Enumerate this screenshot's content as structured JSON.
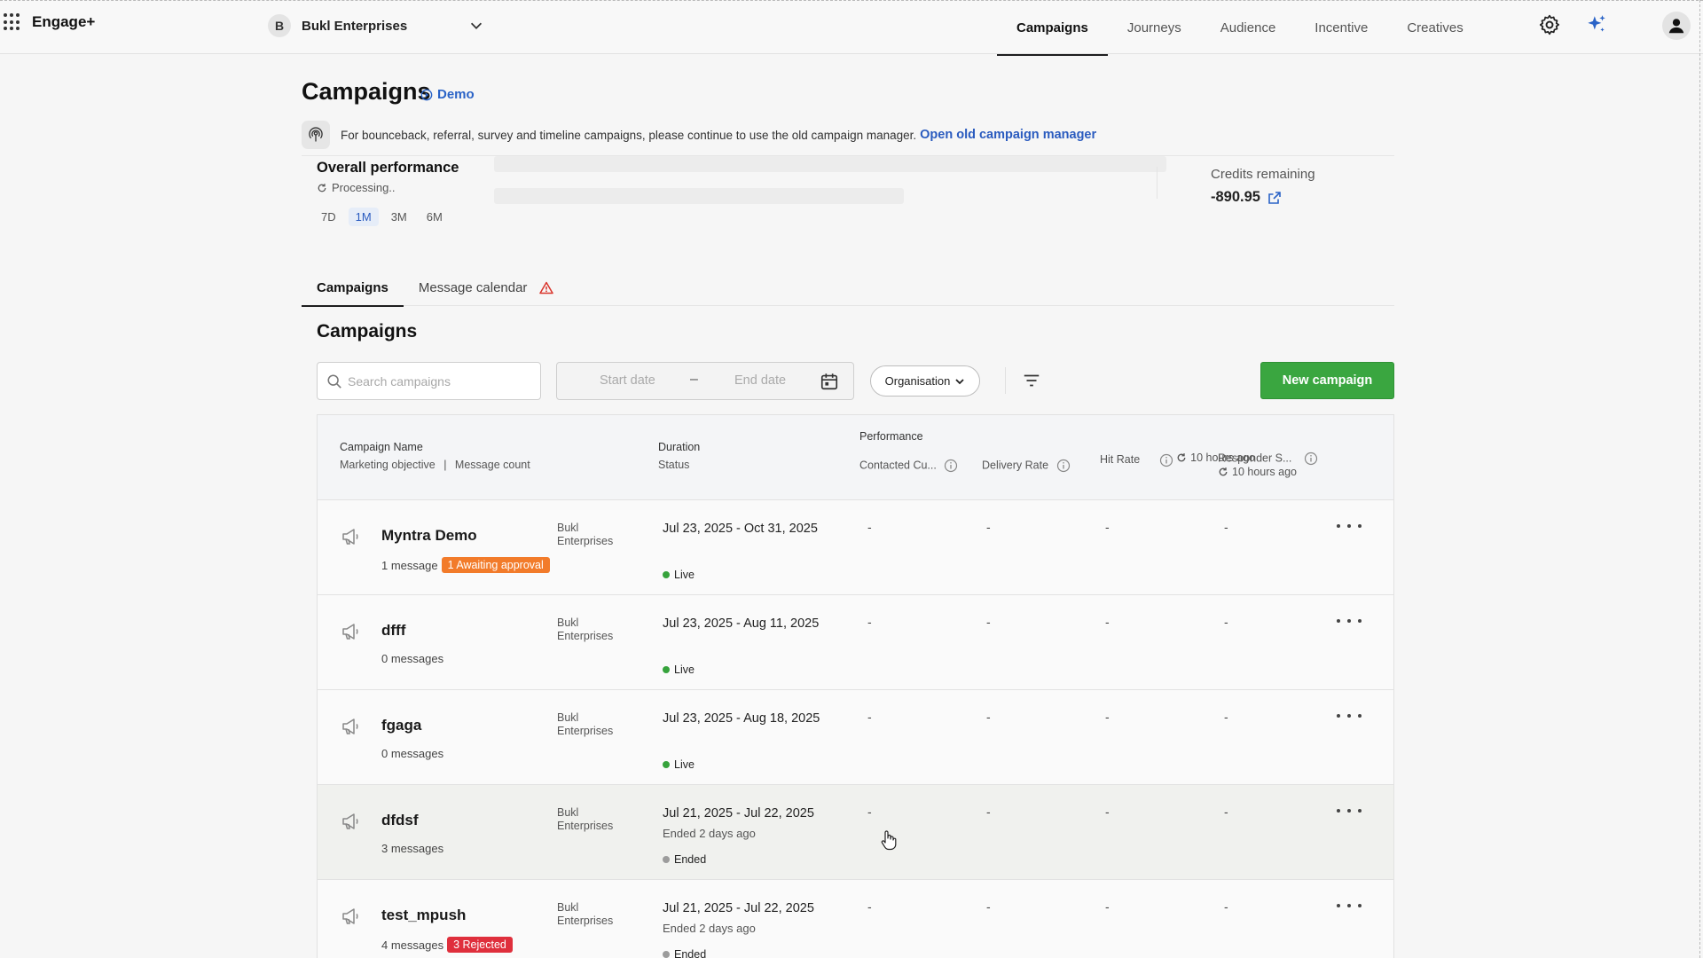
{
  "app": {
    "name": "Engage+"
  },
  "org": {
    "initial": "B",
    "name": "Bukl Enterprises"
  },
  "nav": {
    "items": [
      {
        "label": "Campaigns",
        "active": true
      },
      {
        "label": "Journeys",
        "active": false
      },
      {
        "label": "Audience",
        "active": false
      },
      {
        "label": "Incentive",
        "active": false
      },
      {
        "label": "Creatives",
        "active": false
      }
    ],
    "icons": [
      "gear-icon",
      "sparkle-icon",
      "user-avatar-icon"
    ]
  },
  "page": {
    "title": "Campaigns",
    "demo_label": "Demo",
    "notice_text": "For bounceback, referral, survey and timeline campaigns, please continue to use the old campaign manager.",
    "notice_link": "Open old campaign manager"
  },
  "performance": {
    "title": "Overall performance",
    "status": "Processing..",
    "ranges": [
      "7D",
      "1M",
      "3M",
      "6M"
    ],
    "selected_range": "1M",
    "credits_label": "Credits remaining",
    "credits_value": "-890.95"
  },
  "tabs": [
    {
      "label": "Campaigns",
      "active": true
    },
    {
      "label": "Message calendar",
      "active": false,
      "warning": true
    }
  ],
  "campaigns_section": {
    "title": "Campaigns",
    "search_placeholder": "Search campaigns",
    "start_placeholder": "Start date",
    "date_separator": "–",
    "end_placeholder": "End date",
    "org_filter": "Organisation",
    "new_button": "New campaign"
  },
  "table": {
    "headers": {
      "name": "Campaign Name",
      "objective": "Marketing objective",
      "sep": "|",
      "msg_count": "Message count",
      "duration": "Duration",
      "status": "Status",
      "performance": "Performance",
      "contacted": "Contacted Cu...",
      "delivery": "Delivery Rate",
      "hit_rate": "Hit Rate",
      "hit_sync": "10 hours ago",
      "responder": "Responder S...",
      "responder_sync": "10 hours ago"
    },
    "rows": [
      {
        "name": "Myntra Demo",
        "messages": "1 message",
        "badge": "1 Awaiting approval",
        "badge_color": "#f27b2a",
        "org": "Bukl Enterprises",
        "duration": "Jul 23, 2025 - Oct 31, 2025",
        "ended": "",
        "status": "Live",
        "metrics": [
          "-",
          "-",
          "-",
          "-"
        ]
      },
      {
        "name": "dfff",
        "messages": "0 messages",
        "badge": "",
        "org": "Bukl Enterprises",
        "duration": "Jul 23, 2025 - Aug 11, 2025",
        "ended": "",
        "status": "Live",
        "metrics": [
          "-",
          "-",
          "-",
          "-"
        ]
      },
      {
        "name": "fgaga",
        "messages": "0 messages",
        "badge": "",
        "org": "Bukl Enterprises",
        "duration": "Jul 23, 2025 - Aug 18, 2025",
        "ended": "",
        "status": "Live",
        "metrics": [
          "-",
          "-",
          "-",
          "-"
        ]
      },
      {
        "name": "dfdsf",
        "messages": "3 messages",
        "badge": "",
        "org": "Bukl Enterprises",
        "duration": "Jul 21, 2025 - Jul 22, 2025",
        "ended": "Ended 2 days ago",
        "status": "Ended",
        "metrics": [
          "-",
          "-",
          "-",
          "-"
        ]
      },
      {
        "name": "test_mpush",
        "messages": "4 messages",
        "badge": "3 Rejected",
        "badge_color": "#df2f3c",
        "org": "Bukl Enterprises",
        "duration": "Jul 21, 2025 - Jul 22, 2025",
        "ended": "Ended 2 days ago",
        "status": "Ended",
        "metrics": [
          "-",
          "-",
          "-",
          "-"
        ]
      }
    ]
  },
  "colors": {
    "primary_green": "#3aa640",
    "link_blue": "#2a5bbf",
    "live": "#36a33c",
    "ended": "#9c9c9c"
  }
}
